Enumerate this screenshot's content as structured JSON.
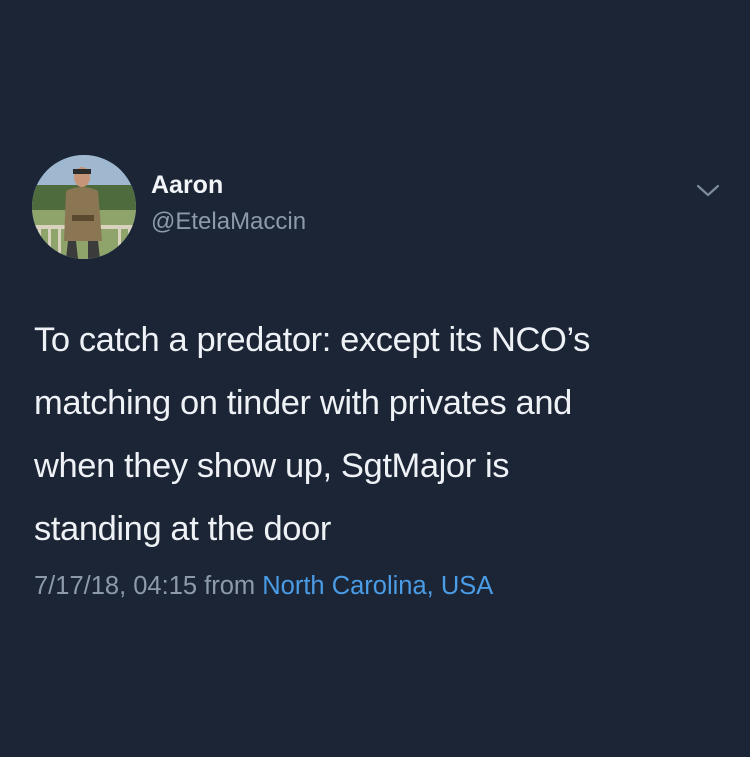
{
  "user": {
    "display_name": "Aaron",
    "handle": "@EtelaMaccin"
  },
  "tweet": {
    "text": "To catch a predator: except its NCO’s\nmatching on tinder with privates and\nwhen they show up, SgtMajor is\nstanding at the door",
    "timestamp": "7/17/18, 04:15",
    "from_label": "from",
    "location": "North Carolina, USA"
  },
  "icons": {
    "menu": "chevron-down-icon",
    "avatar": "avatar"
  },
  "colors": {
    "background": "#1b2535",
    "primary_text": "#eef1f5",
    "secondary_text": "#8d9aab",
    "link": "#4a9ce6"
  }
}
